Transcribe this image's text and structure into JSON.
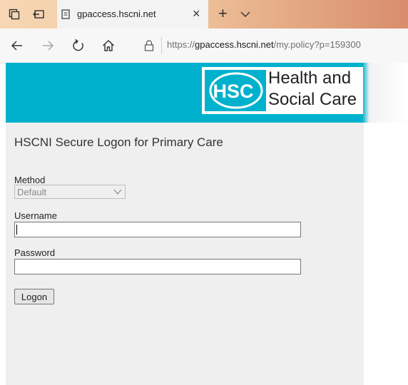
{
  "browser": {
    "tab_title": "gpaccess.hscni.net",
    "close_glyph": "×",
    "newtab_glyph": "+",
    "url_prefix": "https://",
    "url_domain": "gpaccess.hscni.net",
    "url_path": "/my.policy?p=159300"
  },
  "banner": {
    "logo_abbrev": "HSC",
    "logo_line1": "Health and",
    "logo_line2": "Social Care",
    "teal": "#00b1cd"
  },
  "form": {
    "title": "HSCNI Secure Logon for Primary Care",
    "method_label": "Method",
    "method_value": "Default",
    "username_label": "Username",
    "username_value": "",
    "password_label": "Password",
    "password_value": "",
    "logon_label": "Logon"
  },
  "icons": [
    "tab-actions-icon",
    "set-aside-tabs-icon",
    "page-icon",
    "close-icon",
    "new-tab-icon",
    "chevron-down-icon",
    "back-icon",
    "forward-icon",
    "refresh-icon",
    "home-icon",
    "lock-icon"
  ]
}
